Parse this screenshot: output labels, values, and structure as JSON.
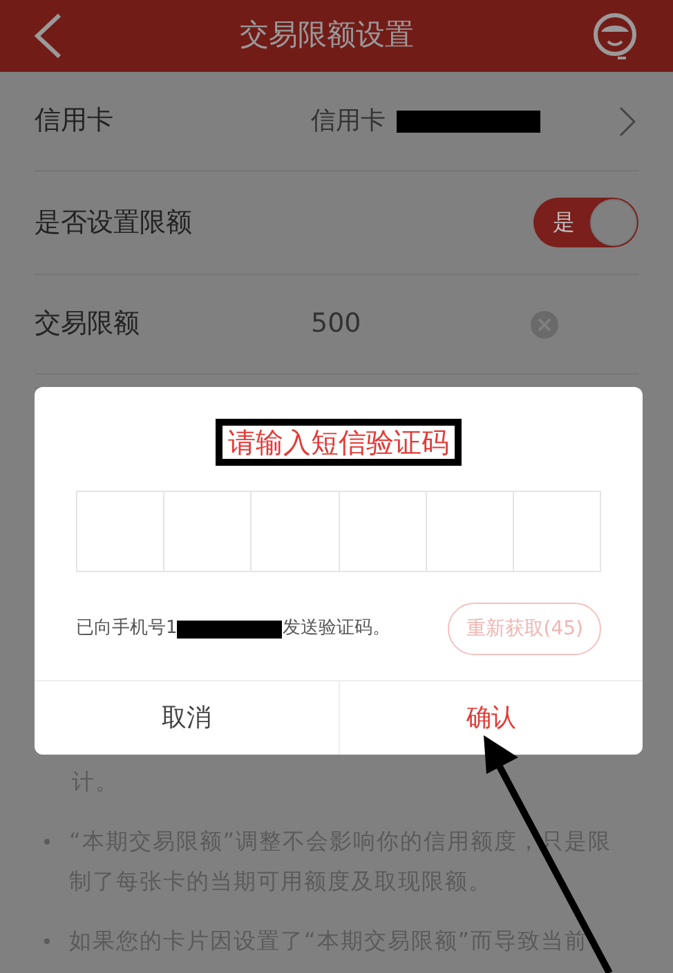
{
  "header": {
    "title": "交易限额设置"
  },
  "rows": [
    {
      "kind": "link",
      "label": "信用卡",
      "value": "信用卡"
    },
    {
      "kind": "switch",
      "label": "是否设置限额",
      "switch_text": "是",
      "on": true
    },
    {
      "kind": "input",
      "label": "交易限额",
      "value": "500"
    }
  ],
  "notes": {
    "fragment": "计。",
    "bullets": [
      "“本期交易限额”调整不会影响你的信用额度，只是限制了每张卡的当期可用额度及取现限额。",
      "如果您的卡片因设置了“本期交易限额”而导致当前"
    ]
  },
  "dialog": {
    "title": "请输入短信验证码",
    "sent_prefix": "已向手机号1",
    "sent_suffix": "发送验证码。",
    "resend": {
      "label": "重新获取(45)",
      "disabled": true
    },
    "buttons": [
      {
        "kind": "cancel",
        "label": "取消"
      },
      {
        "kind": "confirm",
        "label": "确认"
      }
    ]
  }
}
